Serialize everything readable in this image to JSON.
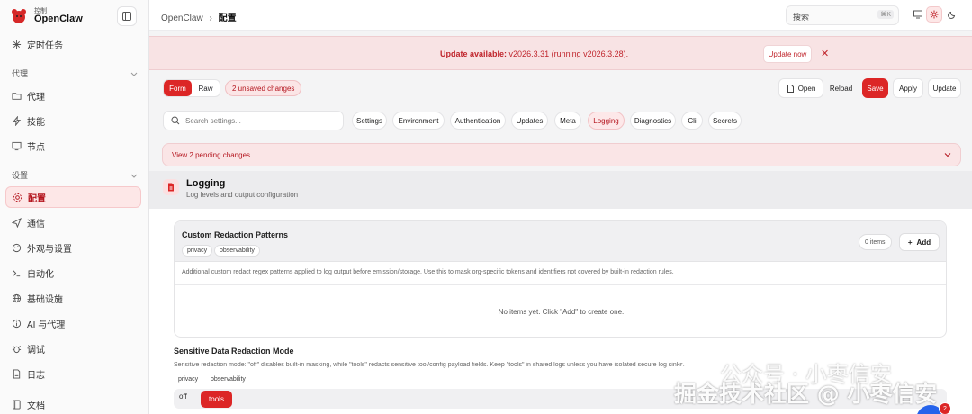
{
  "brand": {
    "top": "控制",
    "name": "OpenClaw"
  },
  "sidebar": {
    "top_item": "定时任务",
    "groups": [
      {
        "label": "代理",
        "items": [
          "代理",
          "技能",
          "节点"
        ]
      },
      {
        "label": "设置",
        "items": [
          "配置",
          "通信",
          "外观与设置",
          "自动化",
          "基础设施",
          "AI 与代理",
          "调试",
          "日志"
        ]
      }
    ],
    "bottom_item": "文档"
  },
  "topbar": {
    "crumb_root": "OpenClaw",
    "crumb_sep": "›",
    "crumb_current": "配置",
    "search_placeholder": "搜索",
    "search_kbd": "⌘K"
  },
  "banner": {
    "label": "Update available:",
    "version_text": "v2026.3.31 (running v2026.3.28).",
    "button": "Update now",
    "close": "✕"
  },
  "toolbar": {
    "mode_form": "Form",
    "mode_raw": "Raw",
    "unsaved": "2 unsaved changes",
    "open": "Open",
    "reload": "Reload",
    "save": "Save",
    "apply": "Apply",
    "update": "Update"
  },
  "search": {
    "placeholder": "Search settings..."
  },
  "chips": [
    "Settings",
    "Environment",
    "Authentication",
    "Updates",
    "Meta",
    "Logging",
    "Diagnostics",
    "Cli",
    "Secrets"
  ],
  "pending": "View 2 pending changes",
  "section": {
    "title": "Logging",
    "subtitle": "Log levels and output configuration"
  },
  "card": {
    "title": "Custom Redaction Patterns",
    "tags": [
      "privacy",
      "observability"
    ],
    "count": "0 items",
    "add": "Add",
    "description": "Additional custom redact regex patterns applied to log output before emission/storage. Use this to mask org-specific tokens and identifiers not covered by built-in redaction rules.",
    "empty": "No items yet. Click \"Add\" to create one."
  },
  "field": {
    "title": "Sensitive Data Redaction Mode",
    "description": "Sensitive redaction mode: \"off\" disables built-in masking, while \"tools\" redacts sensitive tool/config payload fields. Keep \"tools\" in shared logs unless you have isolated secure log sinks.",
    "tags": [
      "privacy",
      "observability"
    ],
    "options": [
      "off",
      "tools"
    ]
  },
  "watermark": {
    "line1": "公众号 · 小枣信安",
    "line2": "掘金技术社区 @ 小枣信安"
  },
  "notification_count": "2",
  "colors": {
    "accent": "#dc2626",
    "banner_bg": "#f8e3e4",
    "active_bg": "#fde7e7"
  }
}
